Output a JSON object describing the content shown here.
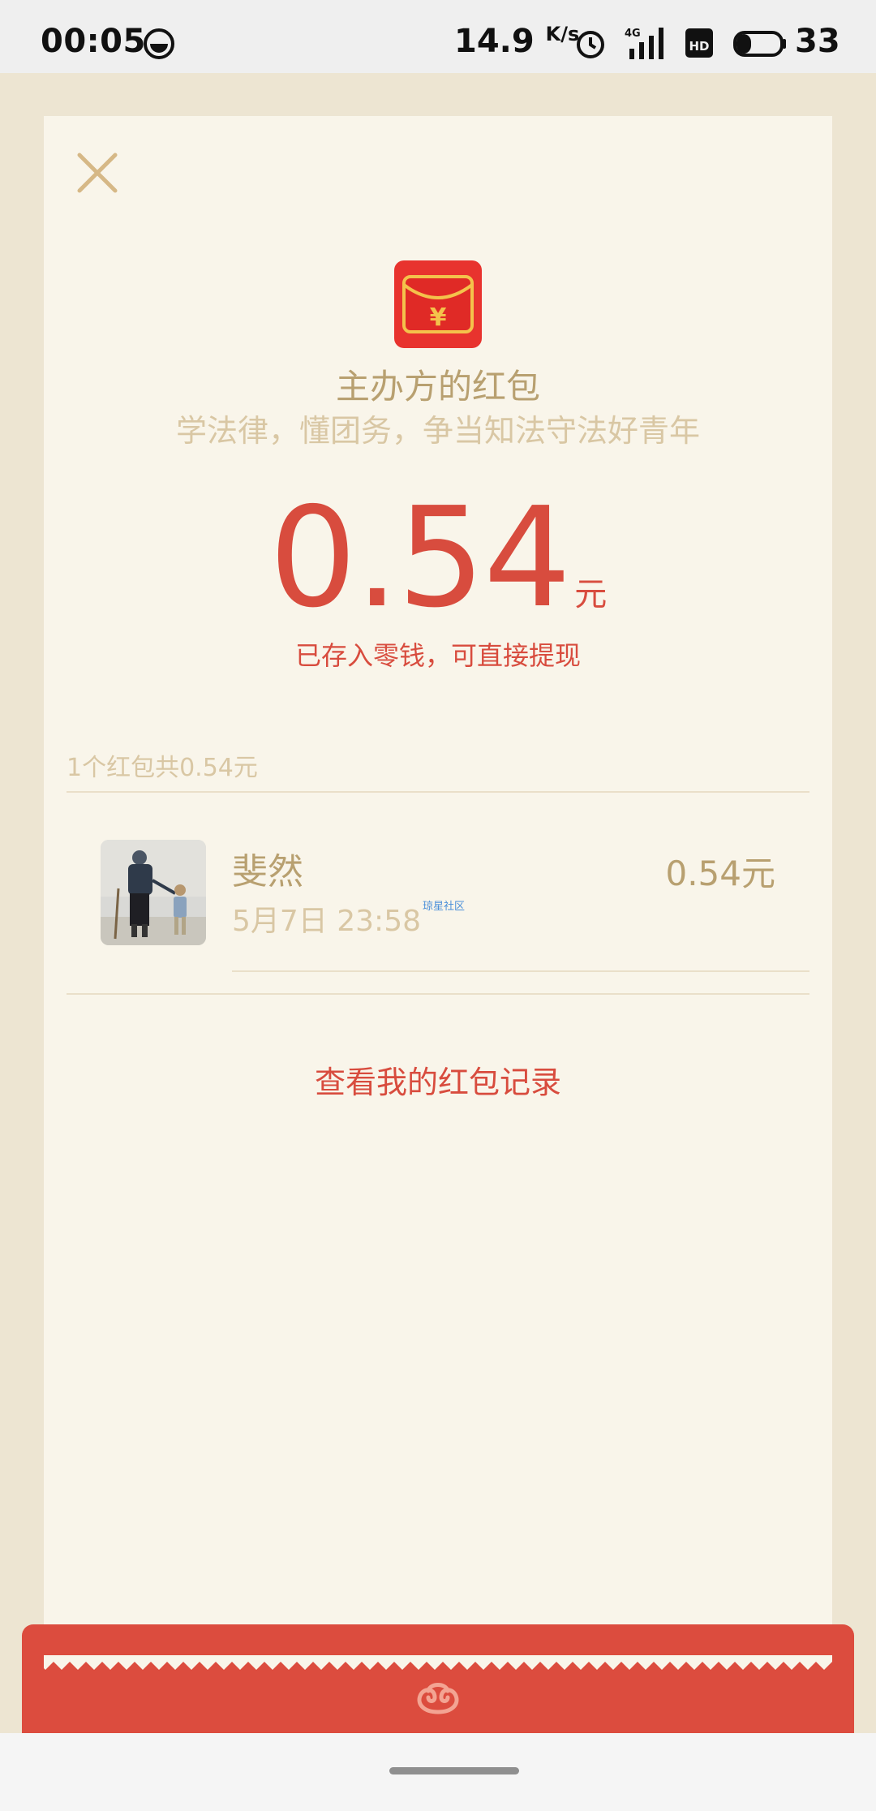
{
  "status_bar": {
    "time": "00:05",
    "speed_value": "14.9",
    "speed_unit": "K/s",
    "signal": "4G",
    "battery": "33",
    "icons": [
      "face-icon",
      "alarm-icon",
      "signal-icon",
      "hd-icon",
      "battery-icon"
    ]
  },
  "card": {
    "close_icon": "close-icon",
    "title": "主办方的红包",
    "subtitle": "学法律，懂团务，争当知法守法好青年",
    "amount": "0.54",
    "amount_unit": "元",
    "saved_text": "已存入零钱，可直接提现",
    "summary": "1个红包共0.54元",
    "records": [
      {
        "name": "斐然",
        "time": "5月7日  23:58",
        "amount": "0.54元",
        "tag": "琼星社区"
      }
    ],
    "view_records": "查看我的红包记录"
  },
  "colors": {
    "accent_red": "#d84c3e",
    "gold": "#b8a070",
    "light_gold": "#d9c7a4",
    "card_bg": "#f9f5ea",
    "page_bg": "#ede5d2"
  }
}
